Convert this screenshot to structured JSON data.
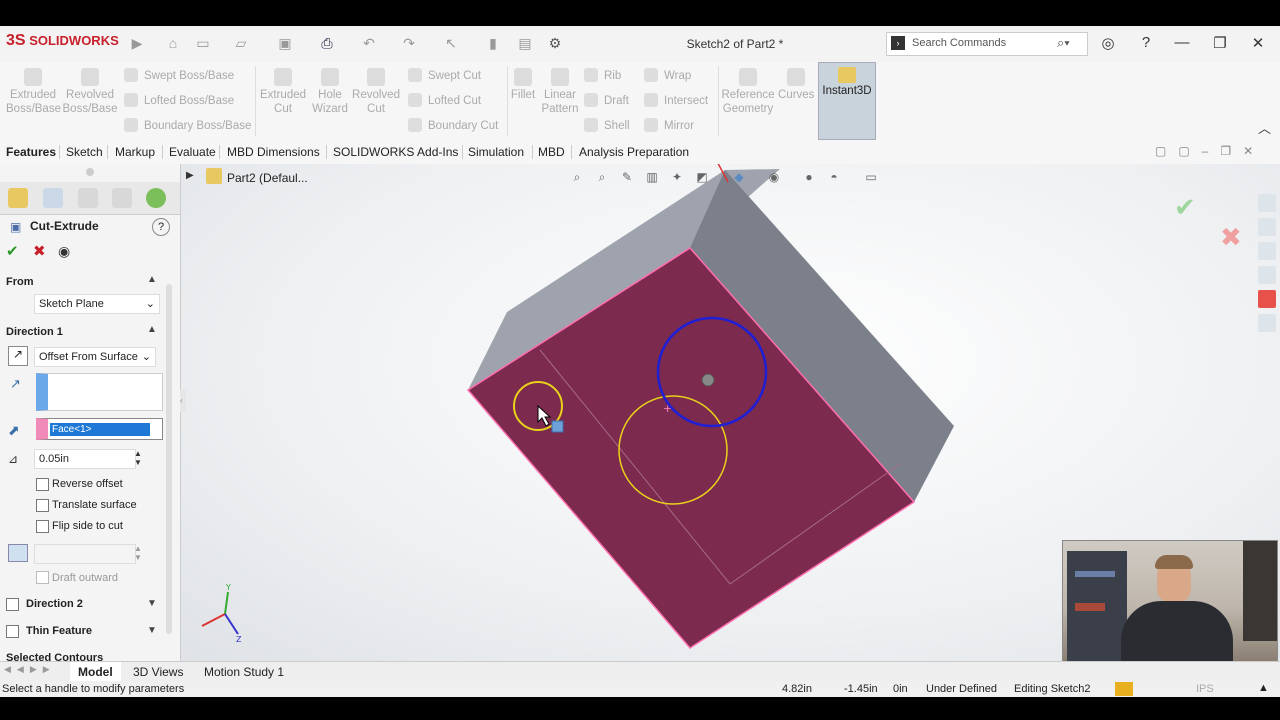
{
  "app": {
    "logo": "SOLIDWORKS",
    "logo_mark": "3S",
    "doc_title": "Sketch2 of Part2 *",
    "search_placeholder": "Search Commands"
  },
  "ribbon": {
    "extruded_boss": [
      "Extruded",
      "Boss/Base"
    ],
    "revolved_boss": [
      "Revolved",
      "Boss/Base"
    ],
    "swept_boss": "Swept Boss/Base",
    "lofted_boss": "Lofted Boss/Base",
    "boundary_boss": "Boundary Boss/Base",
    "extruded_cut": [
      "Extruded",
      "Cut"
    ],
    "hole_wizard": [
      "Hole",
      "Wizard"
    ],
    "revolved_cut": [
      "Revolved",
      "Cut"
    ],
    "swept_cut": "Swept Cut",
    "lofted_cut": "Lofted Cut",
    "boundary_cut": "Boundary Cut",
    "fillet": "Fillet",
    "linear_pattern": [
      "Linear",
      "Pattern"
    ],
    "rib": "Rib",
    "draft": "Draft",
    "shell": "Shell",
    "wrap": "Wrap",
    "intersect": "Intersect",
    "mirror": "Mirror",
    "reference_geometry": [
      "Reference",
      "Geometry"
    ],
    "curves": "Curves",
    "instant3d": "Instant3D"
  },
  "tabs": [
    "Features",
    "Sketch",
    "Markup",
    "Evaluate",
    "MBD Dimensions",
    "SOLIDWORKS Add-Ins",
    "Simulation",
    "MBD",
    "Analysis Preparation"
  ],
  "tree": {
    "part": "Part2",
    "config": "(Defaul..."
  },
  "pm": {
    "title": "Cut-Extrude",
    "from_label": "From",
    "from_value": "Sketch Plane",
    "dir1_label": "Direction 1",
    "dir1_value": "Offset From Surface",
    "face": "Face<1>",
    "offset": "0.05in",
    "reverse_offset": "Reverse offset",
    "translate_surface": "Translate surface",
    "flip_side": "Flip side to cut",
    "draft_outward": "Draft outward",
    "dir2_label": "Direction 2",
    "thin_label": "Thin Feature",
    "selected_contours": "Selected Contours"
  },
  "bottom_tabs": [
    "Model",
    "3D Views",
    "Motion Study 1"
  ],
  "status": {
    "message": "Select a handle to modify parameters",
    "x": "4.82in",
    "y": "-1.45in",
    "z": "0in",
    "state": "Under Defined",
    "editing": "Editing Sketch2",
    "units": "IPS"
  },
  "colors": {
    "face": "#7c2a4e",
    "side": "#7a7f8a",
    "top": "#9aa0aa",
    "blue_circle": "#1f1fd6",
    "yellow_circle": "#e9d21a",
    "accent": "#c8202b"
  }
}
